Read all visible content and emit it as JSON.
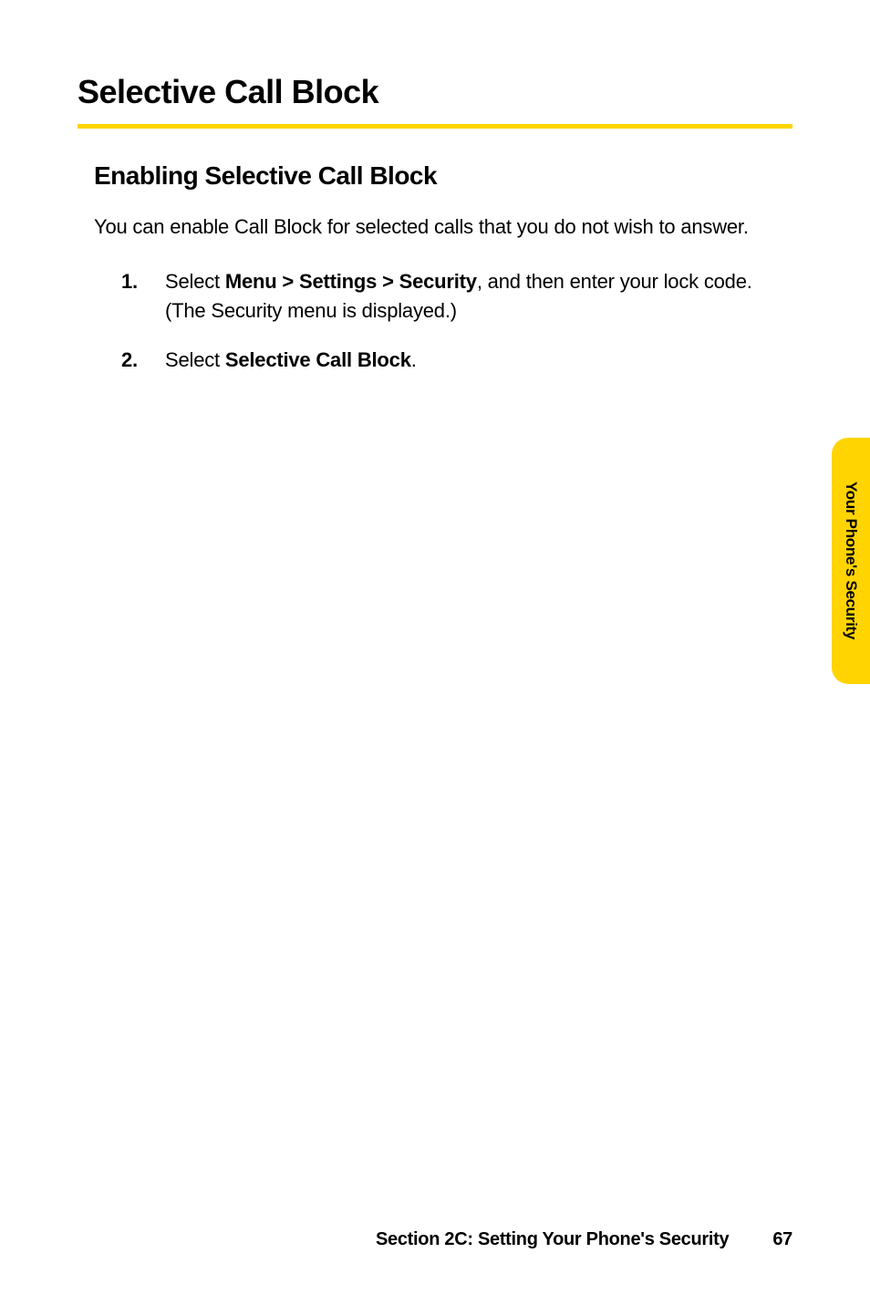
{
  "heading": "Selective Call Block",
  "subheading": "Enabling Selective Call Block",
  "intro": "You can enable Call Block for selected calls that you do not wish to answer.",
  "steps": [
    {
      "number": "1.",
      "prefix": "Select ",
      "bold": "Menu > Settings > Security",
      "suffix": ", and then enter your lock code. (The Security menu is displayed.)"
    },
    {
      "number": "2.",
      "prefix": "Select ",
      "bold": "Selective Call Block",
      "suffix": "."
    }
  ],
  "sideTab": "Your Phone's Security",
  "footer": {
    "section": "Section 2C: Setting Your Phone's Security",
    "page": "67"
  }
}
